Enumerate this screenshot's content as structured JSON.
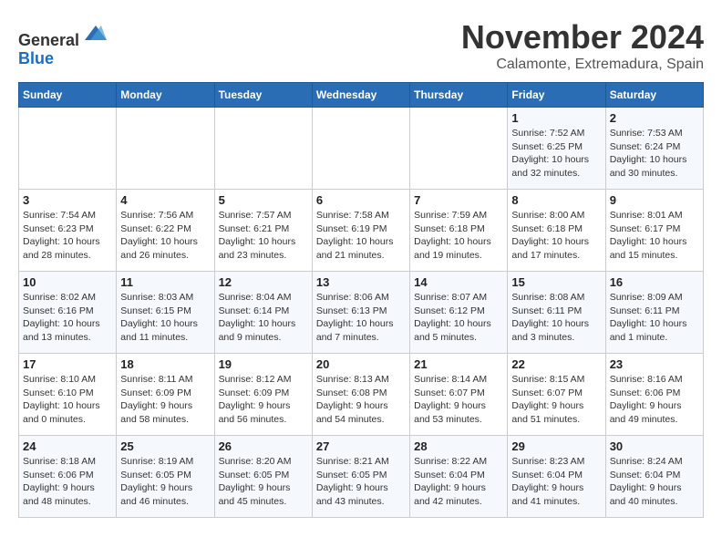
{
  "header": {
    "logo_line1": "General",
    "logo_line2": "Blue",
    "month": "November 2024",
    "location": "Calamonte, Extremadura, Spain"
  },
  "weekdays": [
    "Sunday",
    "Monday",
    "Tuesday",
    "Wednesday",
    "Thursday",
    "Friday",
    "Saturday"
  ],
  "weeks": [
    [
      {
        "day": "",
        "info": ""
      },
      {
        "day": "",
        "info": ""
      },
      {
        "day": "",
        "info": ""
      },
      {
        "day": "",
        "info": ""
      },
      {
        "day": "",
        "info": ""
      },
      {
        "day": "1",
        "info": "Sunrise: 7:52 AM\nSunset: 6:25 PM\nDaylight: 10 hours and 32 minutes."
      },
      {
        "day": "2",
        "info": "Sunrise: 7:53 AM\nSunset: 6:24 PM\nDaylight: 10 hours and 30 minutes."
      }
    ],
    [
      {
        "day": "3",
        "info": "Sunrise: 7:54 AM\nSunset: 6:23 PM\nDaylight: 10 hours and 28 minutes."
      },
      {
        "day": "4",
        "info": "Sunrise: 7:56 AM\nSunset: 6:22 PM\nDaylight: 10 hours and 26 minutes."
      },
      {
        "day": "5",
        "info": "Sunrise: 7:57 AM\nSunset: 6:21 PM\nDaylight: 10 hours and 23 minutes."
      },
      {
        "day": "6",
        "info": "Sunrise: 7:58 AM\nSunset: 6:19 PM\nDaylight: 10 hours and 21 minutes."
      },
      {
        "day": "7",
        "info": "Sunrise: 7:59 AM\nSunset: 6:18 PM\nDaylight: 10 hours and 19 minutes."
      },
      {
        "day": "8",
        "info": "Sunrise: 8:00 AM\nSunset: 6:18 PM\nDaylight: 10 hours and 17 minutes."
      },
      {
        "day": "9",
        "info": "Sunrise: 8:01 AM\nSunset: 6:17 PM\nDaylight: 10 hours and 15 minutes."
      }
    ],
    [
      {
        "day": "10",
        "info": "Sunrise: 8:02 AM\nSunset: 6:16 PM\nDaylight: 10 hours and 13 minutes."
      },
      {
        "day": "11",
        "info": "Sunrise: 8:03 AM\nSunset: 6:15 PM\nDaylight: 10 hours and 11 minutes."
      },
      {
        "day": "12",
        "info": "Sunrise: 8:04 AM\nSunset: 6:14 PM\nDaylight: 10 hours and 9 minutes."
      },
      {
        "day": "13",
        "info": "Sunrise: 8:06 AM\nSunset: 6:13 PM\nDaylight: 10 hours and 7 minutes."
      },
      {
        "day": "14",
        "info": "Sunrise: 8:07 AM\nSunset: 6:12 PM\nDaylight: 10 hours and 5 minutes."
      },
      {
        "day": "15",
        "info": "Sunrise: 8:08 AM\nSunset: 6:11 PM\nDaylight: 10 hours and 3 minutes."
      },
      {
        "day": "16",
        "info": "Sunrise: 8:09 AM\nSunset: 6:11 PM\nDaylight: 10 hours and 1 minute."
      }
    ],
    [
      {
        "day": "17",
        "info": "Sunrise: 8:10 AM\nSunset: 6:10 PM\nDaylight: 10 hours and 0 minutes."
      },
      {
        "day": "18",
        "info": "Sunrise: 8:11 AM\nSunset: 6:09 PM\nDaylight: 9 hours and 58 minutes."
      },
      {
        "day": "19",
        "info": "Sunrise: 8:12 AM\nSunset: 6:09 PM\nDaylight: 9 hours and 56 minutes."
      },
      {
        "day": "20",
        "info": "Sunrise: 8:13 AM\nSunset: 6:08 PM\nDaylight: 9 hours and 54 minutes."
      },
      {
        "day": "21",
        "info": "Sunrise: 8:14 AM\nSunset: 6:07 PM\nDaylight: 9 hours and 53 minutes."
      },
      {
        "day": "22",
        "info": "Sunrise: 8:15 AM\nSunset: 6:07 PM\nDaylight: 9 hours and 51 minutes."
      },
      {
        "day": "23",
        "info": "Sunrise: 8:16 AM\nSunset: 6:06 PM\nDaylight: 9 hours and 49 minutes."
      }
    ],
    [
      {
        "day": "24",
        "info": "Sunrise: 8:18 AM\nSunset: 6:06 PM\nDaylight: 9 hours and 48 minutes."
      },
      {
        "day": "25",
        "info": "Sunrise: 8:19 AM\nSunset: 6:05 PM\nDaylight: 9 hours and 46 minutes."
      },
      {
        "day": "26",
        "info": "Sunrise: 8:20 AM\nSunset: 6:05 PM\nDaylight: 9 hours and 45 minutes."
      },
      {
        "day": "27",
        "info": "Sunrise: 8:21 AM\nSunset: 6:05 PM\nDaylight: 9 hours and 43 minutes."
      },
      {
        "day": "28",
        "info": "Sunrise: 8:22 AM\nSunset: 6:04 PM\nDaylight: 9 hours and 42 minutes."
      },
      {
        "day": "29",
        "info": "Sunrise: 8:23 AM\nSunset: 6:04 PM\nDaylight: 9 hours and 41 minutes."
      },
      {
        "day": "30",
        "info": "Sunrise: 8:24 AM\nSunset: 6:04 PM\nDaylight: 9 hours and 40 minutes."
      }
    ]
  ]
}
